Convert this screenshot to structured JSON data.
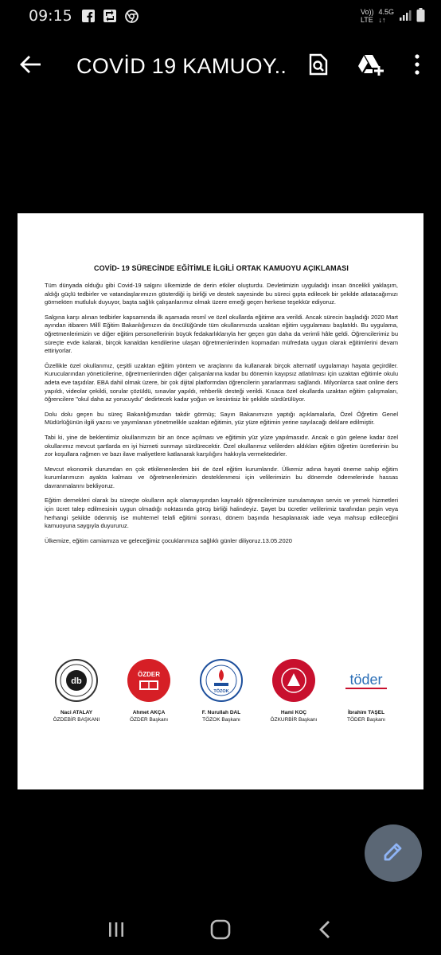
{
  "status_bar": {
    "time": "09:15",
    "network_top": "Vo))",
    "network_bottom": "LTE",
    "network_type": "4.5G",
    "icons_left": [
      "facebook-icon",
      "retweet-icon",
      "chrome-icon"
    ],
    "icons_right": [
      "signal-icon",
      "battery-icon"
    ]
  },
  "app_bar": {
    "title": "COVİD 19 KAMUOY...",
    "actions": [
      "find-in-page-icon",
      "drive-add-icon",
      "more-vert-icon"
    ]
  },
  "document": {
    "heading": "COVİD- 19 SÜRECİNDE EĞİTİMLE İLGİLİ ORTAK KAMUOYU AÇIKLAMASI",
    "paragraphs": [
      "Tüm dünyada olduğu gibi Covid-19 salgını ülkemizde de derin etkiler oluşturdu. Devletimizin uyguladığı insan öncelikli yaklaşım, aldığı güçlü tedbirler ve vatandaşlarımızın gösterdiği iş birliği ve destek sayesinde bu süreci gıpta edilecek bir şekilde atlatacağımızı görmekten mutluluk duyuyor, başta sağlık çalışanlarımız olmak üzere emeği geçen herkese teşekkür ediyoruz.",
      "Salgına karşı alınan tedbirler kapsamında ilk aşamada resmî ve özel okullarda eğitime ara verildi. Ancak sürecin başladığı 2020 Mart ayından itibaren Millî Eğitim Bakanlığımızın da öncülüğünde tüm okullarımızda uzaktan eğitim uygulaması başlatıldı. Bu uygulama, öğretmenlerimizin ve diğer eğitim personellerinin büyük fedakarlıklarıyla her geçen gün daha da verimli hâle geldi. Öğrencilerimiz bu süreçte evde kalarak, birçok kanaldan kendilerine ulaşan öğretmenlerinden kopmadan müfredata uygun olarak eğitimlerini devam ettiriyorlar.",
      "Özellikle özel okullarımız, çeşitli uzaktan eğitim yöntem ve araçlarını da kullanarak birçok alternatif uygulamayı hayata geçirdiler. Kurucularından yöneticilerine, öğretmenlerinden diğer çalışanlarına kadar bu dönemin kayıpsız atlatılması için uzaktan eğitimle okulu adeta eve taşıdılar. EBA dahil olmak üzere, bir çok dijital platformdan öğrencilerin yararlanması sağlandı. Milyonlarca saat online ders yapıldı, videolar çekildi, sorular çözüldü, sınavlar yapıldı, rehberlik desteği verildi. Kısaca özel okullarda uzaktan eğitim çalışmaları, öğrencilere \"okul daha az yorucuydu\" dedirtecek kadar yoğun ve kesintisiz bir şekilde sürdürülüyor.",
      "Dolu dolu geçen bu süreç Bakanlığımızdan takdir görmüş; Sayın Bakanımızın yaptığı açıklamalarla, Özel Öğretim Genel Müdürlüğünün ilgili yazısı ve yayımlanan yönetmelikle uzaktan eğitimin, yüz yüze eğitimin yerine sayılacağı deklare edilmiştir.",
      "Tabi ki, yine de beklentimiz okullarımızın bir an önce açılması ve eğitimin yüz yüze yapılmasıdır. Ancak o gün gelene kadar özel okullarımız mevcut şartlarda en iyi hizmeti sunmayı sürdürecektir. Özel okullarımız velilerden aldıkları eğitim öğretim ücretlerinin bu zor koşullara rağmen ve bazı ilave maliyetlere katlanarak karşılığını hakkıyla vermektedirler.",
      "Mevcut ekonomik durumdan en çok etkilenenlerden biri de özel eğitim kurumlarıdır. Ülkemiz adına hayati öneme sahip eğitim kurumlarımızın ayakta kalması ve öğretmenlerimizin desteklenmesi için velilerimizin bu dönemde ödemelerinde hassas davranmalarını bekliyoruz.",
      "Eğitim dernekleri olarak bu süreçte okulların açık olamayışından kaynaklı öğrencilerimize sunulamayan servis ve yemek hizmetleri için ücret talep edilmesinin uygun olmadığı noktasında görüş birliği halindeyiz. Şayet bu ücretler velilerimiz tarafından peşin veya herhangi şekilde ödenmiş ise muhtemel telafi eğitimi sonrası, dönem başında hesaplanarak iade veya mahsup edileceğini kamuoyuna saygıyla duyururuz.",
      "Ülkemize, eğitim camiamıza ve geleceğimiz çocuklarımıza sağlıklı günler diliyoruz.13.05.2020"
    ],
    "signatories": [
      {
        "name": "Naci ATALAY",
        "title": "ÖZDEBİR BAŞKANI",
        "logo_color": "#1a1a1a",
        "logo_text": "DB"
      },
      {
        "name": "Ahmet AKÇA",
        "title": "ÖZDER Başkanı",
        "logo_color": "#d61f26",
        "logo_text": "ÖZDER"
      },
      {
        "name": "F. Nurullah DAL",
        "title": "TÖZOK Başkanı",
        "logo_color": "#1d4f9c",
        "logo_text": "TÖZOK"
      },
      {
        "name": "Hami KOÇ",
        "title": "ÖZKURBİR Başkanı",
        "logo_color": "#c8102e",
        "logo_text": ""
      },
      {
        "name": "İbrahim TAŞEL",
        "title": "TÖDER Başkanı",
        "logo_color": "#2c6fb7",
        "logo_text": "töder"
      }
    ]
  },
  "fab": {
    "icon": "edit-pencil-icon",
    "color": "#5b6775"
  },
  "nav_bar": {
    "buttons": [
      "recent-apps-icon",
      "home-icon",
      "back-nav-icon"
    ]
  }
}
